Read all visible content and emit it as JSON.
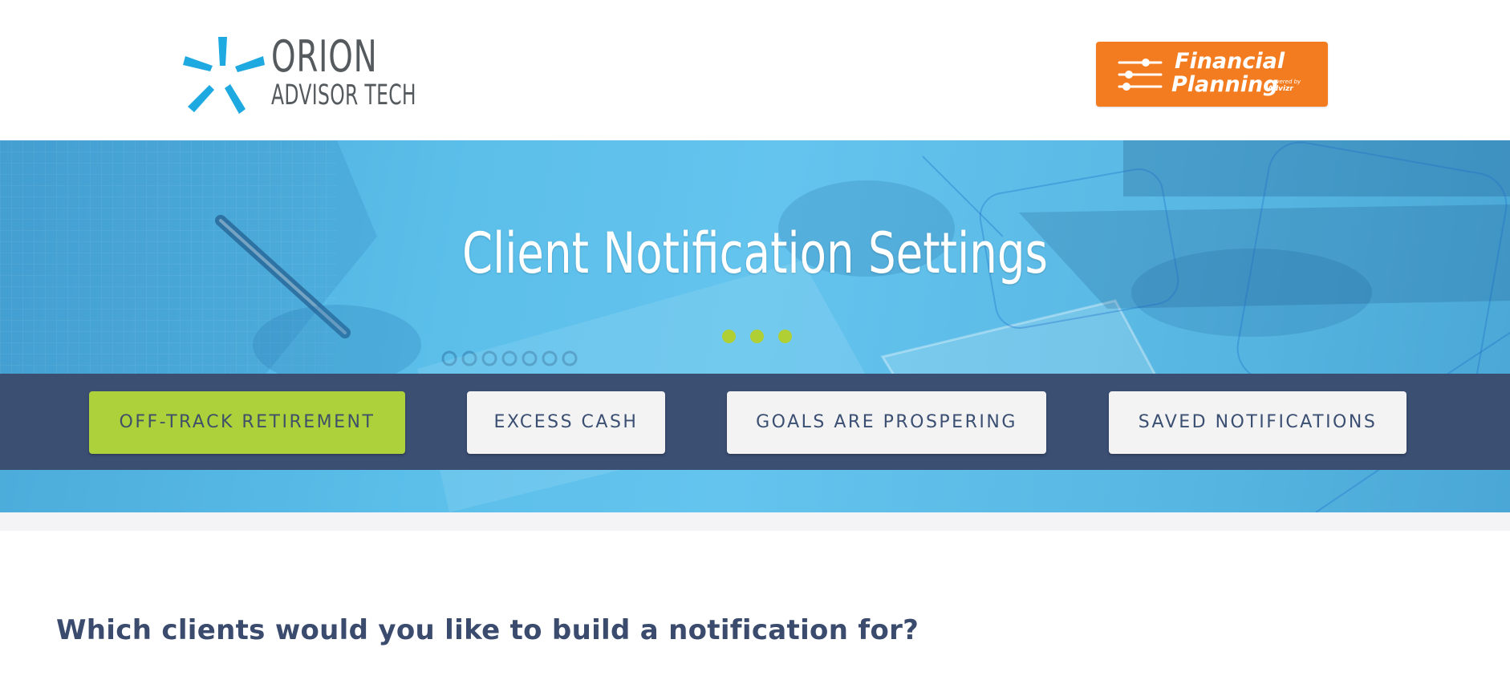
{
  "header": {
    "logo": {
      "line1": "ORION",
      "line2": "ADVISOR TECH",
      "mark_color": "#1fa9e1",
      "text_color": "#555a5e"
    },
    "badge": {
      "line1": "Financial",
      "line2": "Planning",
      "sub1": "powered by",
      "sub2": "Advizr",
      "icon": "sliders-icon",
      "color": "#f47c20"
    }
  },
  "hero": {
    "title": "Client Notification Settings",
    "dots_color": "#b0cf34"
  },
  "nav": {
    "buttons": [
      {
        "label": "OFF-TRACK RETIREMENT",
        "active": true
      },
      {
        "label": "EXCESS CASH",
        "active": false
      },
      {
        "label": "GOALS ARE PROSPERING",
        "active": false
      },
      {
        "label": "SAVED NOTIFICATIONS",
        "active": false
      }
    ],
    "band_color": "#3b4f73",
    "active_color": "#acd13a"
  },
  "main": {
    "question": "Which clients would you like to build a notification for?"
  }
}
